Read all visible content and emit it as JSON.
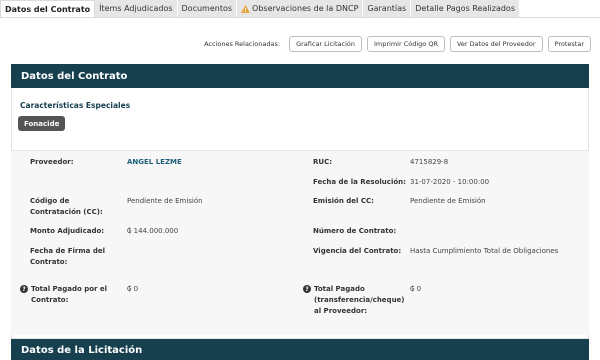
{
  "tabs": [
    {
      "label": "Datos del Contrato",
      "active": true
    },
    {
      "label": "Ítems Adjudicados"
    },
    {
      "label": "Documentos"
    },
    {
      "label": "Observaciones de la DNCP",
      "icon": "warning-icon"
    },
    {
      "label": "Garantías"
    },
    {
      "label": "Detalle Pagos Realizados"
    }
  ],
  "actions": {
    "label": "Acciones Relacionadas:",
    "buttons": [
      "Graficar Licitación",
      "Imprimir Código QR",
      "Ver Datos del Proveedor",
      "Protestar"
    ]
  },
  "section1": {
    "title": "Datos del Contrato",
    "special_title": "Características Especiales",
    "badge": "Fonacide"
  },
  "details": {
    "proveedor_label": "Proveedor:",
    "proveedor_value": "ANGEL LEZME",
    "ruc_label": "RUC:",
    "ruc_value": "4715829-8",
    "fecha_res_label": "Fecha de la Resolución:",
    "fecha_res_value": "31-07-2020 - 10:00:00",
    "codigo_label": "Código de Contratación (CC):",
    "codigo_value": "Pendiente de Emisión",
    "emision_label": "Emisión del CC:",
    "emision_value": "Pendiente de Emisión",
    "monto_label": "Monto Adjudicado:",
    "monto_value": "₲ 144.000.000",
    "numero_label": "Número de Contrato:",
    "numero_value": "",
    "firma_label": "Fecha de Firma del Contrato:",
    "firma_value": "",
    "vigencia_label": "Vigencia del Contrato:",
    "vigencia_value": "Hasta Cumplimiento Total de Obligaciones",
    "total_pagado_label": "Total Pagado por el Contrato:",
    "total_pagado_value": "₲ 0",
    "total_prov_label": "Total Pagado (transferencia/cheque) al Proveedor:",
    "total_prov_value": "₲ 0"
  },
  "section2": {
    "title": "Datos de la Licitación"
  },
  "colors": {
    "header_bg": "#17404f",
    "link": "#1d5f7a",
    "warning": "#e8a33d"
  }
}
